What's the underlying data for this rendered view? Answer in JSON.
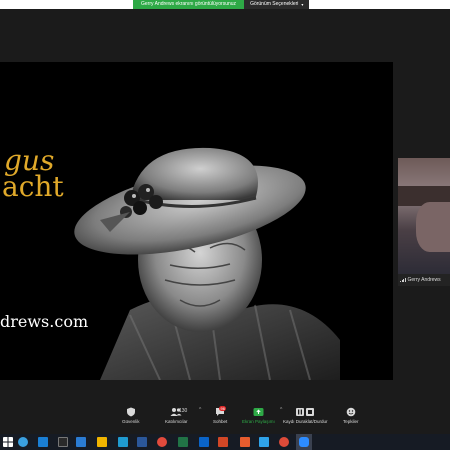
{
  "share_banner": {
    "status": "Gerry Andrews ekranını görüntülüyorsunuz",
    "view_options": "Görünüm Seçenekleri"
  },
  "shared_screen": {
    "title_line1": "gus",
    "title_line2": "acht",
    "website": "drews.com"
  },
  "participant": {
    "name": "Gerry Andrews"
  },
  "controls": {
    "security": "Güvenlik",
    "participants": "Katılımcılar",
    "participants_count": "130",
    "chat": "Sohbet",
    "chat_badge": "96",
    "share_screen": "Ekran Paylaşımı",
    "record": "Kaydı Duraklat/Durdur",
    "reactions": "Tepkiler"
  },
  "colors": {
    "share_green": "#2ea946",
    "title_gold": "#e0a92a",
    "badge_red": "#e02828"
  },
  "taskbar": {
    "icons": [
      "windows-start-icon",
      "search-icon",
      "edge-icon",
      "store-icon",
      "terminal-icon",
      "folder-icon",
      "mail-icon",
      "photos-icon",
      "word-icon",
      "chrome-icon",
      "excel-icon",
      "onedrive-icon",
      "powerpoint-icon",
      "app-icon",
      "app-icon",
      "lightroom-icon",
      "photoshop-icon",
      "chrome-icon",
      "zoom-icon"
    ]
  }
}
